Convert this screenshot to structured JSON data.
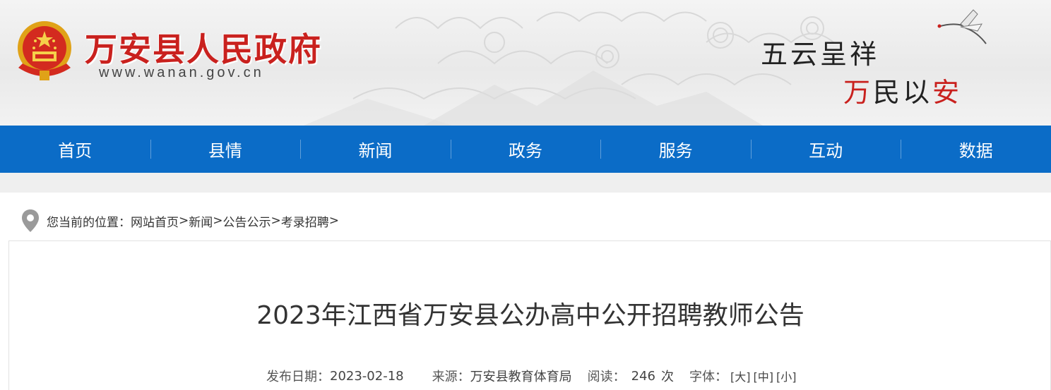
{
  "header": {
    "site_title": "万安县人民政府",
    "site_url": "www.wanan.gov.cn",
    "slogan_line1": "五云呈祥",
    "slogan_line2_chars": [
      "万",
      "民",
      "以",
      "安"
    ],
    "accent_red": "#c9211e",
    "emblem_icon": "national-emblem-icon",
    "crane_icon": "crane-icon"
  },
  "nav": {
    "background": "#0b6cc7",
    "items": [
      {
        "label": "首页"
      },
      {
        "label": "县情"
      },
      {
        "label": "新闻"
      },
      {
        "label": "政务"
      },
      {
        "label": "服务"
      },
      {
        "label": "互动"
      },
      {
        "label": "数据"
      }
    ]
  },
  "breadcrumb": {
    "icon": "location-pin-icon",
    "prefix": "您当前的位置：",
    "items": [
      "网站首页",
      "新闻",
      "公告公示",
      "考录招聘"
    ],
    "separator": ">"
  },
  "article": {
    "title": "2023年江西省万安县公办高中公开招聘教师公告",
    "meta": {
      "date_label": "发布日期：",
      "date": "2023-02-18",
      "source_label": "来源：",
      "source": "万安县教育体育局",
      "views_label": "阅读：",
      "views": "246",
      "views_unit": "次",
      "font_label": "字体：",
      "font_large": "[大]",
      "font_medium": "[中]",
      "font_small": "[小]"
    }
  }
}
